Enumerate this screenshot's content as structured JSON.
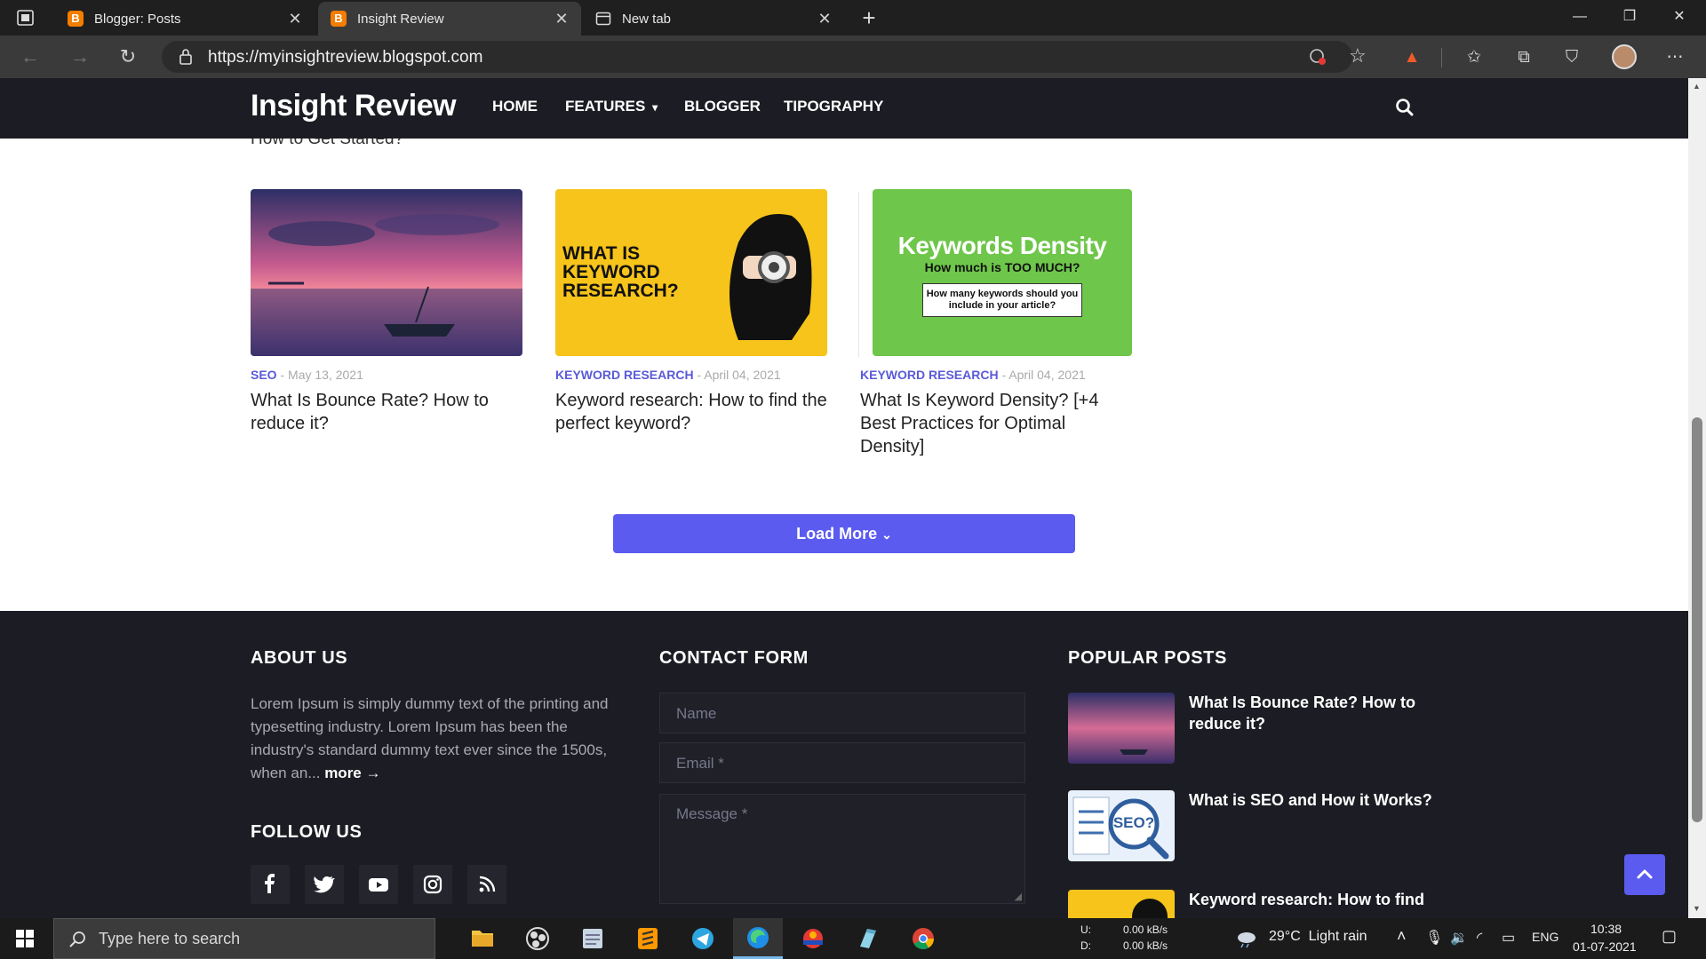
{
  "browser": {
    "tabs": [
      {
        "title": "Blogger: Posts"
      },
      {
        "title": "Insight Review"
      },
      {
        "title": "New tab"
      }
    ],
    "url": "https://myinsightreview.blogspot.com"
  },
  "site": {
    "logo": "Insight Review",
    "menu": [
      "HOME",
      "FEATURES",
      "BLOGGER",
      "TIPOGRAPHY"
    ]
  },
  "content": {
    "clipped_title": "How to Get Started?",
    "posts": [
      {
        "category": "SEO",
        "date": "May 13, 2021",
        "title": "What Is Bounce Rate? How to reduce it?"
      },
      {
        "category": "KEYWORD RESEARCH",
        "date": "April 04, 2021",
        "title": "Keyword research: How to find the perfect keyword?",
        "image_text": "WHAT IS KEYWORD RESEARCH?"
      },
      {
        "category": "KEYWORD RESEARCH",
        "date": "April 04, 2021",
        "title": "What Is Keyword Density? [+4 Best Practices for Optimal Density]",
        "image_title": "Keywords Density",
        "image_subtitle": "How much is TOO MUCH?",
        "image_box": "How many keywords should you include in your article?"
      }
    ],
    "load_more": "Load More"
  },
  "footer": {
    "about": {
      "heading": "ABOUT US",
      "text": "Lorem Ipsum is simply dummy text of the printing and typesetting industry. Lorem Ipsum has been the industry's standard dummy text ever since the 1500s, when an...",
      "more": "more →"
    },
    "follow_heading": "FOLLOW US",
    "social_icons": [
      "facebook-icon",
      "twitter-icon",
      "youtube-icon",
      "instagram-icon",
      "rss-icon"
    ],
    "contact": {
      "heading": "CONTACT FORM",
      "name_placeholder": "Name",
      "email_placeholder": "Email *",
      "message_placeholder": "Message *"
    },
    "popular": {
      "heading": "POPULAR POSTS",
      "items": [
        {
          "title": "What Is Bounce Rate? How to reduce it?"
        },
        {
          "title": "What is SEO and How it Works?",
          "image_text": "SEO?"
        },
        {
          "title": "Keyword research: How to find"
        }
      ]
    }
  },
  "taskbar": {
    "search_placeholder": "Type here to search",
    "net_up": "0.00 kB/s",
    "net_down": "0.00 kB/s",
    "net_up_label": "U:",
    "net_down_label": "D:",
    "weather": "29°C  Light rain",
    "language": "ENG",
    "time": "10:38",
    "date": "01-07-2021"
  },
  "colors": {
    "accent": "#5b5bf0",
    "header_bg": "#1c1d24",
    "category": "#5a5ad8"
  }
}
